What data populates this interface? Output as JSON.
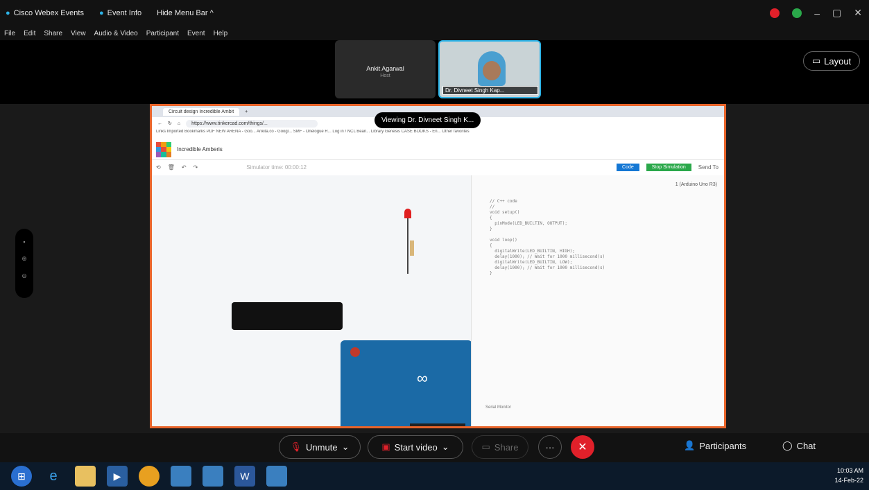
{
  "titlebar": {
    "app": "Cisco Webex Events",
    "event_info": "Event Info",
    "hide_menu": "Hide Menu Bar ^"
  },
  "menu": [
    "File",
    "Edit",
    "Share",
    "View",
    "Audio & Video",
    "Participant",
    "Event",
    "Help"
  ],
  "participants_strip": [
    {
      "name": "Ankit Agarwal",
      "role": "Host"
    },
    {
      "name": "Dr. Divneet Singh Kap..."
    }
  ],
  "layout_label": "Layout",
  "viewing_banner": "Viewing Dr. Divneet Singh K...",
  "browser": {
    "tab": "Circuit design Incredible Ambit",
    "url": "https://www.tinkercad.com/things/...",
    "bookmarks": "Links  Imported Bookmarks  PDF  NEW ARENA - Goo...  Ankita.co - Googl...  SMF - Onelogue R...  Log in / NCL Bean...  Library Genesis  CASE BOOKS - En...  Other favorites",
    "project_title": "Incredible Amberis",
    "sim_timer": "Simulator time: 00:00:12",
    "code_btn": "Code",
    "sim_btn": "Stop Simulation",
    "send_to": "Send To",
    "editor_mode": "1 (Arduino Uno R3)",
    "serial_monitor": "Serial Monitor"
  },
  "code_lines": [
    "// C++ code",
    "//",
    "void setup()",
    "{",
    "  pinMode(LED_BUILTIN, OUTPUT);",
    "}",
    "",
    "void loop()",
    "{",
    "  digitalWrite(LED_BUILTIN, HIGH);",
    "  delay(1000); // Wait for 1000 millisecond(s)",
    "  digitalWrite(LED_BUILTIN, LOW);",
    "  delay(1000); // Wait for 1000 millisecond(s)",
    "}"
  ],
  "controls": {
    "unmute": "Unmute",
    "start_video": "Start video",
    "share": "Share",
    "participants": "Participants",
    "chat": "Chat"
  },
  "clock": {
    "time": "10:03 AM",
    "date": "14-Feb-22"
  },
  "colors": {
    "share_border": "#e8642a",
    "end_call": "#e0202a",
    "tile_border": "#2db4e8"
  }
}
